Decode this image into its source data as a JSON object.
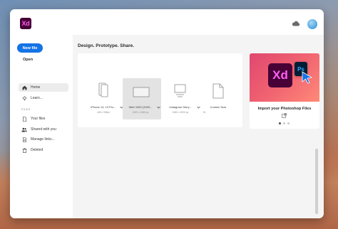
{
  "app": {
    "logo_text": "Xd"
  },
  "sidebar": {
    "new_file_label": "New file",
    "open_label": "Open",
    "files_section": "FILES",
    "items": [
      {
        "label": "Home",
        "icon": "home-icon",
        "active": true
      },
      {
        "label": "Learn...",
        "icon": "lightbulb-icon",
        "active": false
      },
      {
        "label": "Your files",
        "icon": "file-icon",
        "active": false
      },
      {
        "label": "Shared with you",
        "icon": "people-icon",
        "active": false
      },
      {
        "label": "Manage links...",
        "icon": "link-icon",
        "active": false
      },
      {
        "label": "Deleted",
        "icon": "trash-icon",
        "active": false
      }
    ]
  },
  "main": {
    "title": "Design. Prototype. Share.",
    "presets": [
      {
        "name": "iPhone 13, 13 Pro...",
        "size": "428 x 926px",
        "icon": "phone-icon",
        "has_dropdown": true,
        "selected": false
      },
      {
        "name": "Web 1920 (1920...",
        "size": "1920 x 1080 px",
        "icon": "web-icon",
        "has_dropdown": true,
        "selected": true
      },
      {
        "name": "Instagram Story...",
        "size": "1080 x 1920 px",
        "icon": "instagram-icon",
        "has_dropdown": true,
        "selected": false
      },
      {
        "name": "Custom Size",
        "size": "W",
        "icon": "custom-size-icon",
        "has_dropdown": false,
        "selected": false
      }
    ],
    "import_card": {
      "title": "Import your Photoshop Files",
      "art_xd_text": "Xd",
      "art_ps_text": "Ps",
      "carousel_pages": 3,
      "carousel_active": 1
    }
  },
  "colors": {
    "accent": "#1473e6",
    "xd_bg": "#470137",
    "xd_fg": "#ff61f6",
    "ps_bg": "#001e36",
    "ps_fg": "#31a8ff"
  }
}
